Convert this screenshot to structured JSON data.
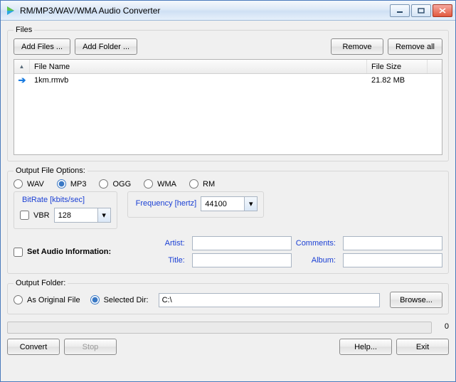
{
  "titlebar": {
    "title": "RM/MP3/WAV/WMA Audio Converter"
  },
  "files_group": {
    "legend": "Files",
    "add_files": "Add Files ...",
    "add_folder": "Add Folder ...",
    "remove": "Remove",
    "remove_all": "Remove all",
    "col_name": "File Name",
    "col_size": "File Size",
    "rows": [
      {
        "name": "1km.rmvb",
        "size": "21.82 MB"
      }
    ]
  },
  "options_group": {
    "legend": "Output File Options:",
    "formats": {
      "wav": "WAV",
      "mp3": "MP3",
      "ogg": "OGG",
      "wma": "WMA",
      "rm": "RM"
    },
    "bitrate_legend": "BitRate [kbits/sec]",
    "vbr": "VBR",
    "bitrate_value": "128",
    "freq_legend": "Frequency [hertz]",
    "freq_value": "44100",
    "set_audio_info": "Set Audio Information:",
    "labels": {
      "artist": "Artist:",
      "title": "Title:",
      "comments": "Comments:",
      "album": "Album:"
    },
    "values": {
      "artist": "",
      "title": "",
      "comments": "",
      "album": ""
    }
  },
  "outfolder_group": {
    "legend": "Output Folder:",
    "as_original": "As Original File",
    "selected_dir": "Selected Dir:",
    "path": "C:\\",
    "browse": "Browse..."
  },
  "progress_value": "0",
  "bottom": {
    "convert": "Convert",
    "stop": "Stop",
    "help": "Help...",
    "exit": "Exit"
  }
}
